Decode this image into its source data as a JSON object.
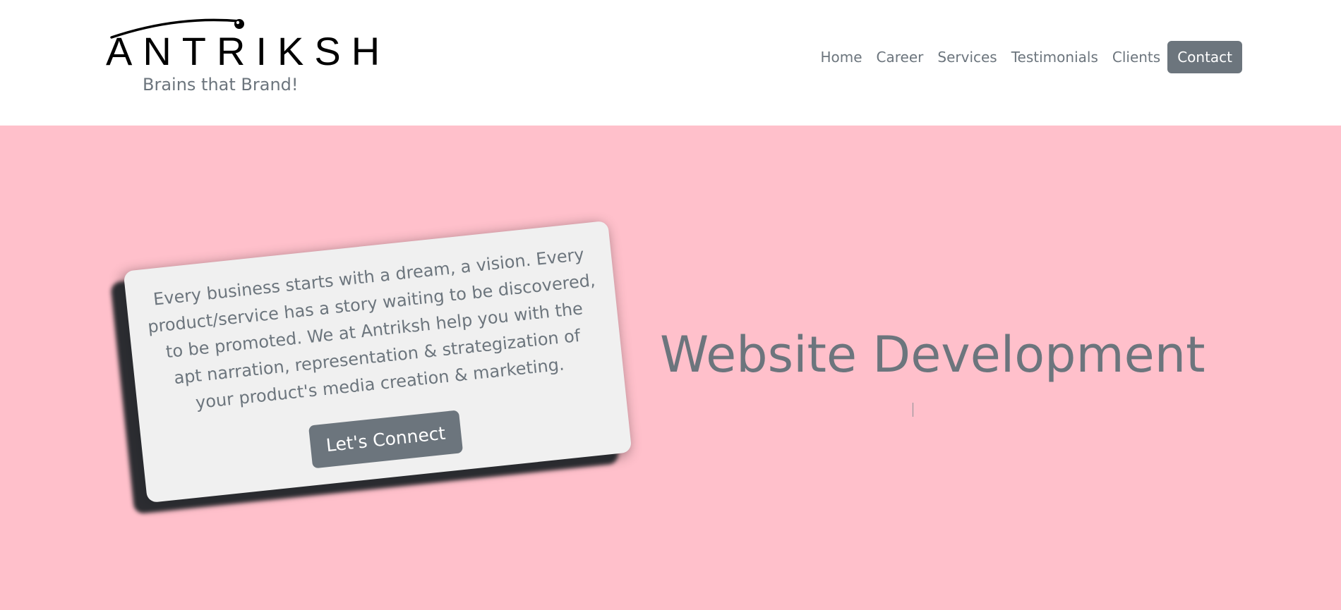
{
  "brand": {
    "name": "ANTRIKSH",
    "tagline": "Brains that Brand!"
  },
  "nav": {
    "items": [
      {
        "label": "Home"
      },
      {
        "label": "Career"
      },
      {
        "label": "Services"
      },
      {
        "label": "Testimonials"
      },
      {
        "label": "Clients"
      }
    ],
    "contact_label": "Contact"
  },
  "hero": {
    "card_text": "Every business starts with a dream, a vision. Every product/service has a story waiting to be discovered, to be promoted. We at Antriksh help you with the apt narration, representation & strategization of your product's media creation & marketing.",
    "cta_label": "Let's Connect",
    "headline": "Website Development"
  },
  "colors": {
    "hero_background": "#ffc0cb",
    "accent_gray": "#6c757d",
    "card_background": "#f0f0f0",
    "header_background": "#ffffff"
  }
}
